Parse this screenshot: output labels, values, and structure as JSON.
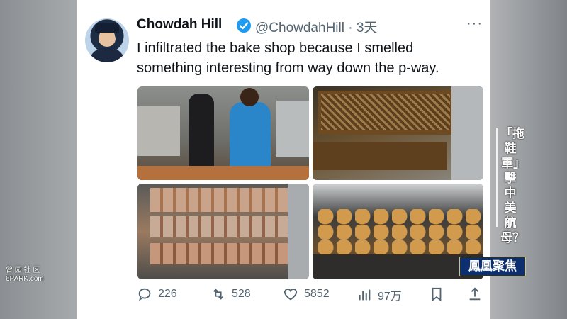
{
  "tweet": {
    "display_name": "Chowdah Hill",
    "handle_time": "@ChowdahHill · 3天",
    "more": "···",
    "text_line1": "I infiltrated the bake shop because I smelled",
    "text_line2": "something interesting from way down the p-way.",
    "photos": [
      "kitchen-staff-photo",
      "sheet-cake-rack-photo",
      "cinnamon-rolls-rack-photo",
      "muffins-rack-photo"
    ],
    "actions": {
      "replies": "226",
      "retweets": "528",
      "likes": "5852",
      "views": "97万"
    }
  },
  "overlay": {
    "vertical_caption": "「拖鞋軍」擊中美航母？",
    "broadcaster_logo": "鳳凰聚焦",
    "watermark_line1": "曾 园 社 区",
    "watermark_line2": "6PARK.com"
  },
  "colors": {
    "verified": "#1d9bf0",
    "text": "#0f1419",
    "muted": "#536471",
    "logo_bg": "#0d2f6f"
  }
}
